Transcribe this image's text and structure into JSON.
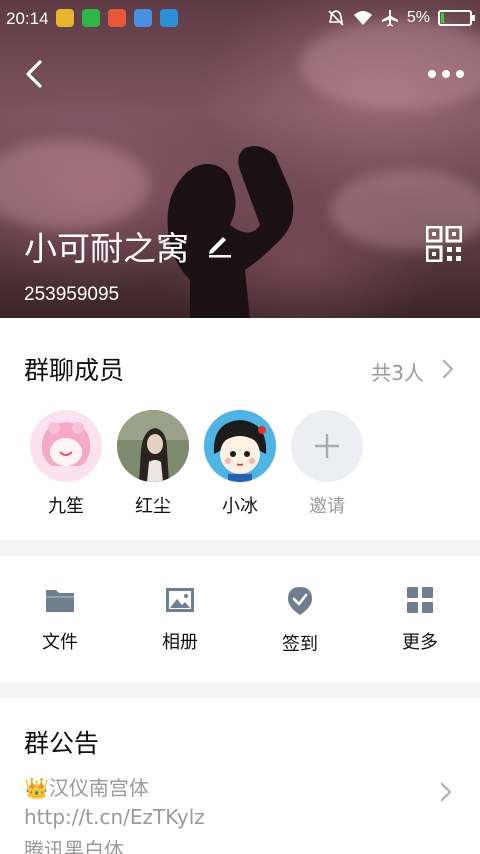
{
  "status_bar": {
    "time": "20:14",
    "battery_percent": "5%",
    "battery_level": 0.05
  },
  "header": {
    "group_name": "小可耐之窝",
    "group_id": "253959095"
  },
  "members": {
    "title": "群聊成员",
    "count_label": "共3人",
    "items": [
      {
        "name": "九笙"
      },
      {
        "name": "红尘"
      },
      {
        "name": "小冰"
      }
    ],
    "invite_label": "邀请"
  },
  "actions": [
    {
      "label": "文件",
      "icon": "folder-icon"
    },
    {
      "label": "相册",
      "icon": "image-icon"
    },
    {
      "label": "签到",
      "icon": "checkin-icon"
    },
    {
      "label": "更多",
      "icon": "grid-icon"
    }
  ],
  "notice": {
    "title": "群公告",
    "lines": [
      "👑汉仪南宫体",
      "http://t.cn/EzTKylz",
      "腾讯黑白体..."
    ]
  },
  "colors": {
    "accent_gray": "#9a9a9a",
    "icon_gray": "#6f7f8f",
    "page_bg": "#f4f5f7"
  }
}
